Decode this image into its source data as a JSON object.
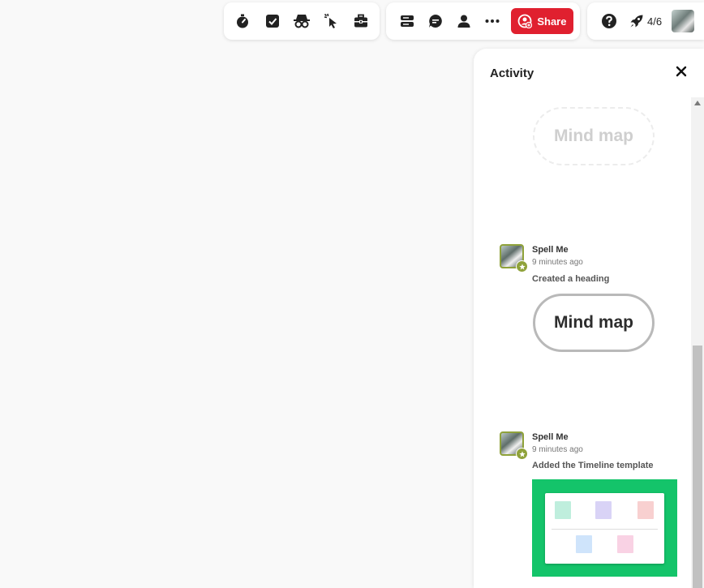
{
  "toolbar_left": {
    "icons": [
      "timer-icon",
      "checkbox-icon",
      "spy-icon",
      "cursor-click-icon",
      "toolbox-icon"
    ]
  },
  "toolbar_mid": {
    "icons": [
      "cards-icon",
      "comment-icon",
      "person-icon",
      "more-icon"
    ],
    "share_label": "Share",
    "share_color": "#e0202f"
  },
  "toolbar_right": {
    "progress": "4/6"
  },
  "activity": {
    "title": "Activity",
    "faded_heading": "Mind map",
    "entries": [
      {
        "user": "Spell Me",
        "time": "9 minutes ago",
        "action": "Created a heading",
        "heading": "Mind map"
      },
      {
        "user": "Spell Me",
        "time": "9 minutes ago",
        "action": "Added the Timeline template",
        "thumbnail_color": "#14c46a"
      }
    ]
  }
}
